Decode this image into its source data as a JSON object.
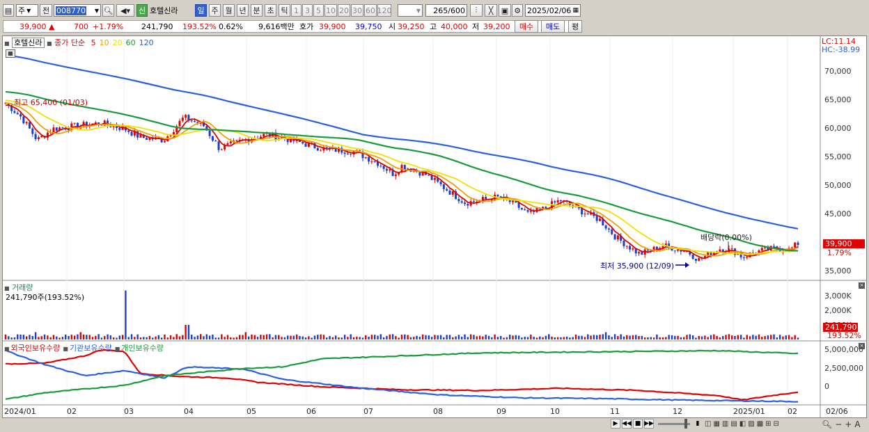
{
  "toolbar": {
    "type_select": "주",
    "prev_label": "전",
    "code": "008770",
    "stock_name_badge": "신",
    "stock_name": "호텔신라",
    "periods": [
      "일",
      "주",
      "월",
      "년",
      "분",
      "초",
      "틱"
    ],
    "active_period": "일",
    "intervals": [
      "1",
      "3",
      "5",
      "10",
      "20",
      "30",
      "60",
      "120"
    ],
    "count": "265",
    "count_total": "/600",
    "date": "2025/02/06"
  },
  "info": {
    "price": "39,900",
    "arrow": "▲",
    "change": "700",
    "change_pct": "+1.79%",
    "volume": "241,790",
    "volume_ratio": "193.52%",
    "turnover": "0.62%",
    "amount": "9,616백만",
    "hoga_label": "호가",
    "ask": "39,900",
    "bid": "39,750",
    "open_label": "시",
    "open": "39,250",
    "high_label": "고",
    "high": "40,000",
    "low_label": "저",
    "low": "39,200",
    "buy_label": "매수",
    "sell_label": "매도",
    "avg_label": "평"
  },
  "price_panel": {
    "name": "호텔신라",
    "ma_title": "종가 단순",
    "ma_periods": [
      "5",
      "10",
      "20",
      "60",
      "120"
    ],
    "ma_colors": [
      "#e00000",
      "#f0a000",
      "#f2e000",
      "#1a9a3a",
      "#2a5fe0"
    ],
    "lc": "LC:11.14",
    "hc": "HC:-38.99",
    "y_ticks": [
      "70,000",
      "65,000",
      "60,000",
      "55,000",
      "50,000",
      "45,000",
      "40,000",
      "35,000"
    ],
    "high_note": "최고 65,400 (01/03)",
    "low_note": "최저 35,900 (12/09)",
    "dividend_note": "배당락(0.00%)",
    "price_tag": "39,900",
    "pct_tag": "1.79%"
  },
  "volume_panel": {
    "title": "거래량",
    "value": "241,790주(193.52%)",
    "y_ticks": [
      "3,000K",
      "2,000K",
      "1,000K"
    ],
    "tag": "241,790",
    "pct": "193.52%"
  },
  "holding_panel": {
    "series": [
      "외국인보유수량",
      "기관보유수량",
      "개인보유수량"
    ],
    "colors": [
      "#e00000",
      "#2a5fe0",
      "#1a9a3a"
    ],
    "y_ticks": [
      "5,000,000",
      "2,500,000",
      "0"
    ]
  },
  "x_labels": [
    "2024/01",
    "02",
    "03",
    "04",
    "05",
    "06",
    "07",
    "08",
    "09",
    "10",
    "11",
    "12",
    "2025/01",
    "02",
    "02/06"
  ]
}
